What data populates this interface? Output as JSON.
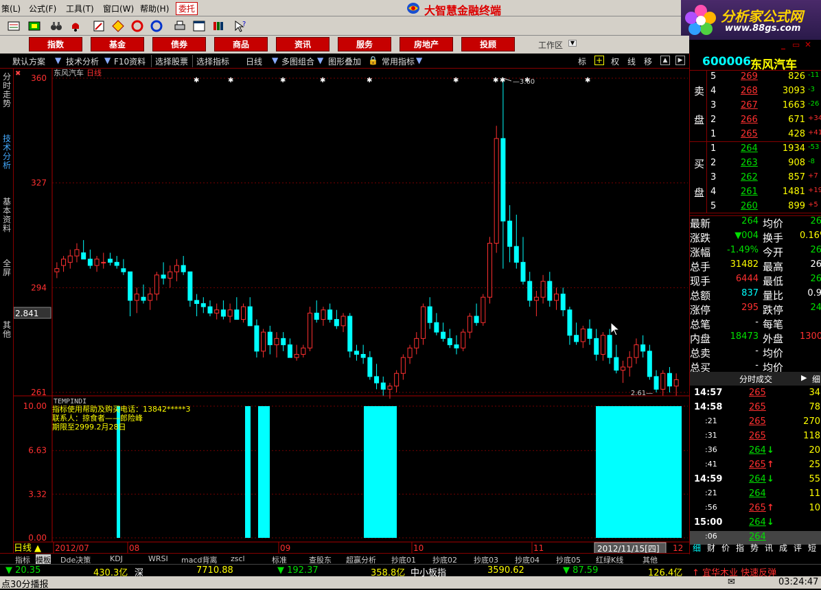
{
  "menubar": {
    "items": [
      "策(L)",
      "公式(F)",
      "工具(T)",
      "窗口(W)",
      "帮助(H)"
    ],
    "weituo": "委托",
    "app_title": "大智慧金融终端"
  },
  "brand": {
    "name": "分析家公式网",
    "url": "www.88gs.com"
  },
  "categories": [
    "指数",
    "基金",
    "债券",
    "商品",
    "资讯",
    "服务",
    "房地产",
    "投顾"
  ],
  "workarea": "工作区",
  "subbar": [
    "默认方案",
    "技术分析",
    "F10资料",
    "选择股票",
    "选择指标",
    "日线",
    "多图组合",
    "图形叠加",
    "常用指标"
  ],
  "subbar_right": [
    "标",
    "权",
    "线",
    "移"
  ],
  "left_tabs": [
    "分时走势",
    "技术分析",
    "基本资料",
    "全屏",
    "其他"
  ],
  "chart": {
    "stock_label": "东风汽车",
    "period_label": "日线",
    "y_ticks": [
      "360",
      "327",
      "294",
      "261"
    ],
    "cursor_value": "2.841",
    "high_label": "3.60",
    "low_label": "2.61",
    "indicator_name": "TEMPINDI",
    "indicator_lines": [
      "指标使用帮助及购买电话：13842*****3",
      "联系人：掠食者——郎险峰",
      "期限至2999.2月28日"
    ],
    "ind_ticks": [
      "10.00",
      "6.63",
      "3.32",
      "0.00"
    ],
    "x_labels": [
      "2012/07",
      "08",
      "09",
      "10",
      "11"
    ],
    "date_box": "2012/11/15[四]",
    "x_last": "12"
  },
  "chart_data": {
    "type": "candlestick",
    "ylim": [
      261,
      360
    ],
    "candles": [
      [
        299,
        302,
        297,
        300
      ],
      [
        301,
        304,
        299,
        303
      ],
      [
        302,
        306,
        300,
        304
      ],
      [
        304,
        308,
        302,
        306
      ],
      [
        305,
        309,
        303,
        303
      ],
      [
        303,
        306,
        300,
        301
      ],
      [
        301,
        304,
        299,
        303
      ],
      [
        302,
        305,
        300,
        302
      ],
      [
        303,
        305,
        301,
        302
      ],
      [
        302,
        304,
        300,
        301
      ],
      [
        300,
        303,
        298,
        299
      ],
      [
        299,
        299,
        285,
        290
      ],
      [
        290,
        294,
        286,
        292
      ],
      [
        291,
        295,
        289,
        290
      ],
      [
        290,
        294,
        287,
        292
      ],
      [
        292,
        299,
        290,
        298
      ],
      [
        298,
        302,
        295,
        297
      ],
      [
        297,
        301,
        294,
        299
      ],
      [
        299,
        303,
        296,
        301
      ],
      [
        301,
        304,
        298,
        299
      ],
      [
        299,
        299,
        288,
        290
      ],
      [
        290,
        292,
        285,
        289
      ],
      [
        289,
        291,
        286,
        288
      ],
      [
        288,
        290,
        285,
        286
      ],
      [
        286,
        289,
        284,
        287
      ],
      [
        287,
        290,
        284,
        285
      ],
      [
        285,
        289,
        283,
        287
      ],
      [
        287,
        291,
        284,
        284
      ],
      [
        284,
        289,
        283,
        288
      ],
      [
        288,
        291,
        284,
        282
      ],
      [
        282,
        284,
        272,
        274
      ],
      [
        274,
        281,
        272,
        280
      ],
      [
        280,
        282,
        273,
        276
      ],
      [
        276,
        280,
        272,
        278
      ],
      [
        278,
        280,
        274,
        276
      ],
      [
        276,
        278,
        273,
        272
      ],
      [
        272,
        276,
        271,
        273
      ],
      [
        273,
        276,
        272,
        275
      ],
      [
        275,
        288,
        274,
        286
      ],
      [
        286,
        290,
        283,
        284
      ],
      [
        284,
        288,
        282,
        287
      ],
      [
        287,
        289,
        283,
        284
      ],
      [
        284,
        287,
        281,
        282
      ],
      [
        282,
        286,
        280,
        285
      ],
      [
        285,
        286,
        272,
        274
      ],
      [
        274,
        276,
        271,
        273
      ],
      [
        273,
        276,
        270,
        272
      ],
      [
        272,
        274,
        265,
        266
      ],
      [
        266,
        270,
        262,
        264
      ],
      [
        264,
        266,
        260,
        262
      ],
      [
        262,
        264,
        259,
        263
      ],
      [
        263,
        268,
        261,
        267
      ],
      [
        267,
        273,
        265,
        272
      ],
      [
        272,
        276,
        270,
        275
      ],
      [
        275,
        280,
        273,
        278
      ],
      [
        278,
        289,
        276,
        288
      ],
      [
        288,
        291,
        281,
        283
      ],
      [
        283,
        286,
        279,
        280
      ],
      [
        280,
        283,
        277,
        278
      ],
      [
        278,
        281,
        275,
        276
      ],
      [
        276,
        279,
        273,
        275
      ],
      [
        275,
        281,
        274,
        280
      ],
      [
        280,
        286,
        278,
        285
      ],
      [
        285,
        289,
        282,
        283
      ],
      [
        283,
        292,
        282,
        291
      ],
      [
        291,
        310,
        289,
        308
      ],
      [
        308,
        345,
        305,
        341
      ],
      [
        341,
        360,
        300,
        315
      ],
      [
        315,
        320,
        302,
        307
      ],
      [
        307,
        317,
        300,
        302
      ],
      [
        302,
        310,
        295,
        296
      ],
      [
        296,
        299,
        288,
        290
      ],
      [
        290,
        293,
        285,
        291
      ],
      [
        291,
        298,
        289,
        296
      ],
      [
        296,
        299,
        288,
        290
      ],
      [
        290,
        294,
        287,
        292
      ],
      [
        292,
        294,
        285,
        287
      ],
      [
        287,
        288,
        276,
        279
      ],
      [
        279,
        283,
        276,
        277
      ],
      [
        277,
        282,
        275,
        281
      ],
      [
        281,
        284,
        276,
        278
      ],
      [
        278,
        281,
        271,
        273
      ],
      [
        273,
        280,
        271,
        279
      ],
      [
        279,
        281,
        270,
        272
      ],
      [
        272,
        276,
        267,
        268
      ],
      [
        268,
        271,
        264,
        269
      ],
      [
        269,
        274,
        266,
        272
      ],
      [
        272,
        278,
        270,
        276
      ],
      [
        276,
        279,
        272,
        274
      ],
      [
        274,
        276,
        265,
        266
      ],
      [
        266,
        268,
        261,
        262
      ],
      [
        262,
        268,
        260,
        267
      ],
      [
        267,
        269,
        261,
        263
      ],
      [
        263,
        267,
        260,
        265
      ]
    ],
    "indicator": {
      "ylim": [
        0,
        10
      ],
      "bars": [
        [
          170,
          175
        ],
        [
          357,
          365
        ],
        [
          376,
          393
        ],
        [
          530,
          578
        ],
        [
          868,
          993
        ]
      ]
    }
  },
  "right": {
    "code": "600006",
    "name": "东风汽车",
    "sell_label": [
      "卖",
      "盘"
    ],
    "buy_label": [
      "买",
      "盘"
    ],
    "sell": [
      {
        "lvl": "5",
        "price": "269",
        "vol": "826",
        "chg": "-11"
      },
      {
        "lvl": "4",
        "price": "268",
        "vol": "3093",
        "chg": "-3"
      },
      {
        "lvl": "3",
        "price": "267",
        "vol": "1663",
        "chg": "-26"
      },
      {
        "lvl": "2",
        "price": "266",
        "vol": "671",
        "chg": "+34"
      },
      {
        "lvl": "1",
        "price": "265",
        "vol": "428",
        "chg": "+41"
      }
    ],
    "buy": [
      {
        "lvl": "1",
        "price": "264",
        "vol": "1934",
        "chg": "-53"
      },
      {
        "lvl": "2",
        "price": "263",
        "vol": "908",
        "chg": "-8"
      },
      {
        "lvl": "3",
        "price": "262",
        "vol": "857",
        "chg": "+7"
      },
      {
        "lvl": "4",
        "price": "261",
        "vol": "1481",
        "chg": "+19"
      },
      {
        "lvl": "5",
        "price": "260",
        "vol": "899",
        "chg": "+5"
      }
    ],
    "stats": [
      {
        "k1": "最新",
        "v1": "264",
        "c1": "green",
        "k2": "均价",
        "v2": "26",
        "c2": "green"
      },
      {
        "k1": "涨跌",
        "v1": "▼004",
        "c1": "green",
        "k2": "换手",
        "v2": "0.16%",
        "c2": "yellow"
      },
      {
        "k1": "涨幅",
        "v1": "-1.49%",
        "c1": "green",
        "k2": "今开",
        "v2": "26",
        "c2": "green"
      },
      {
        "k1": "总手",
        "v1": "31482",
        "c1": "yellow",
        "k2": "最高",
        "v2": "26",
        "c2": "white"
      },
      {
        "k1": "现手",
        "v1": "6444",
        "c1": "red",
        "k2": "最低",
        "v2": "26",
        "c2": "green"
      },
      {
        "k1": "总额",
        "v1": "837",
        "c1": "cyan",
        "k2": "量比",
        "v2": "0.9",
        "c2": "white"
      },
      {
        "k1": "涨停",
        "v1": "295",
        "c1": "red",
        "k2": "跌停",
        "v2": "24",
        "c2": "green"
      },
      {
        "k1": "总笔",
        "v1": "-",
        "c1": "white",
        "k2": "每笔",
        "v2": "",
        "c2": "white"
      },
      {
        "k1": "内盘",
        "v1": "18473",
        "c1": "green",
        "k2": "外盘",
        "v2": "1300",
        "c2": "red"
      },
      {
        "k1": "总卖",
        "v1": "-",
        "c1": "white",
        "k2": "均价",
        "v2": "",
        "c2": "white"
      },
      {
        "k1": "总买",
        "v1": "-",
        "c1": "white",
        "k2": "均价",
        "v2": "",
        "c2": "white"
      }
    ],
    "ticks_header": "分时成交",
    "ticks_header2": "细",
    "ticks": [
      {
        "t": "14:57",
        "p": "265",
        "arrow": "",
        "v": "34",
        "bold": true
      },
      {
        "t": "14:58",
        "p": "265",
        "arrow": "",
        "v": "78",
        "bold": true
      },
      {
        "t": ":21",
        "p": "265",
        "arrow": "",
        "v": "270",
        "bold": false
      },
      {
        "t": ":31",
        "p": "265",
        "arrow": "",
        "v": "118",
        "bold": false
      },
      {
        "t": ":36",
        "p": "264",
        "arrow": "down",
        "v": "20",
        "bold": false
      },
      {
        "t": ":41",
        "p": "265",
        "arrow": "up",
        "v": "25",
        "bold": false
      },
      {
        "t": "14:59",
        "p": "264",
        "arrow": "down",
        "v": "55",
        "bold": true
      },
      {
        "t": ":21",
        "p": "264",
        "arrow": "",
        "v": "11",
        "bold": false
      },
      {
        "t": ":56",
        "p": "265",
        "arrow": "up",
        "v": "10",
        "bold": false
      },
      {
        "t": "15:00",
        "p": "264",
        "arrow": "down",
        "v": "",
        "bold": true
      },
      {
        "t": ":06",
        "p": "264",
        "arrow": "",
        "v": "",
        "bold": false
      }
    ],
    "bottom_tabs": [
      "细",
      "财",
      "价",
      "指",
      "势",
      "讯",
      "成",
      "评",
      "短"
    ]
  },
  "bottom_tabs": [
    "指标",
    "模板",
    "Dde决策",
    "KDJ",
    "WRSI",
    "macd背离",
    "zscl",
    "标准",
    "查股东",
    "超赢分析",
    "抄底01",
    "抄底02",
    "抄底03",
    "抄底04",
    "抄底05",
    "红绿K线",
    "其他"
  ],
  "index_bar": [
    {
      "text": "▼ 20.35",
      "cls": "green"
    },
    {
      "text": "430.3亿",
      "cls": "yellow"
    },
    {
      "text": "深",
      "cls": "white"
    },
    {
      "text": "7710.88",
      "cls": "yellow"
    },
    {
      "text": "▼ 192.37",
      "cls": "green"
    },
    {
      "text": "358.8亿",
      "cls": "yellow"
    },
    {
      "text": "中小板指",
      "cls": "white"
    },
    {
      "text": "3590.62",
      "cls": "yellow"
    },
    {
      "text": "▼ 87.59",
      "cls": "green"
    },
    {
      "text": "126.4亿",
      "cls": "yellow"
    },
    {
      "text": "↑ 宜华木业 快速反弹",
      "cls": "red"
    }
  ],
  "status": {
    "left": "点30分播报",
    "time": "03:24:47"
  }
}
